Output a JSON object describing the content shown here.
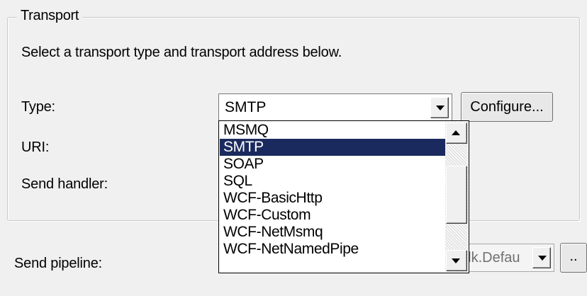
{
  "transport": {
    "group_title": "Transport",
    "instruction": "Select a transport type and transport address below.",
    "type_label": "Type:",
    "type_value": "SMTP",
    "configure_label": "Configure...",
    "uri_label": "URI:",
    "send_handler_label": "Send handler:"
  },
  "dropdown": {
    "items": [
      "MSMQ",
      "SMTP",
      "SOAP",
      "SQL",
      "WCF-BasicHttp",
      "WCF-Custom",
      "WCF-NetMsmq",
      "WCF-NetNamedPipe"
    ],
    "selected": "SMTP"
  },
  "pipeline": {
    "label": "Send pipeline:",
    "value": "alk.Defau",
    "ellipsis_label": ".."
  },
  "colors": {
    "selection_bg": "#1b2a5e",
    "window_bg": "#f0f0f0"
  }
}
